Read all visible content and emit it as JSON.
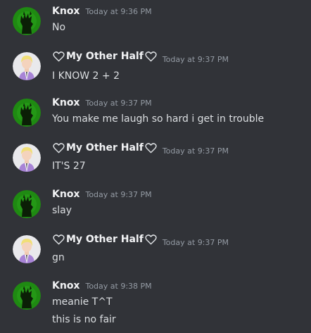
{
  "messages": [
    {
      "author": "Knox",
      "timestamp": "Today at 9:36 PM",
      "lines": [
        "No"
      ]
    },
    {
      "author": "My Other Half",
      "timestamp": "Today at 9:37 PM",
      "lines": [
        "I KNOW 2 + 2"
      ]
    },
    {
      "author": "Knox",
      "timestamp": "Today at 9:37 PM",
      "lines": [
        "You make me laugh so hard i get in trouble"
      ]
    },
    {
      "author": "My Other Half",
      "timestamp": "Today at 9:37 PM",
      "lines": [
        "IT'S 27"
      ]
    },
    {
      "author": "Knox",
      "timestamp": "Today at 9:37 PM",
      "lines": [
        "slay"
      ]
    },
    {
      "author": "My Other Half",
      "timestamp": "Today at 9:37 PM",
      "lines": [
        "gn"
      ]
    },
    {
      "author": "Knox",
      "timestamp": "Today at 9:38 PM",
      "lines": [
        "meanie T^T",
        "this is no fair"
      ]
    }
  ],
  "icons": {
    "knox_avatar": "green-dragon-silhouette-avatar",
    "other_half_avatar": "blonde-person-purple-suit-avatar",
    "name_decoration": "heart-outline-icon"
  },
  "colors": {
    "background": "#313338",
    "author": "#f2f3f5",
    "text": "#dbdee1",
    "timestamp": "#949ba4",
    "knox_avatar_bg": "#1f8a12"
  }
}
